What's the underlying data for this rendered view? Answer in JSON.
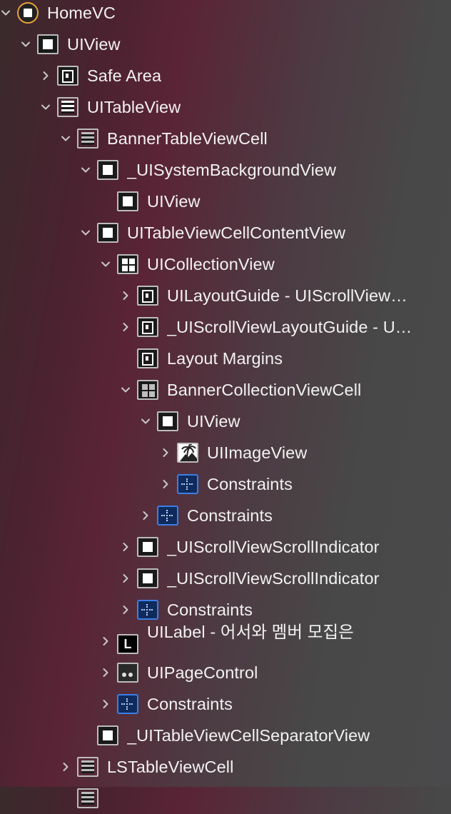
{
  "rows": [
    {
      "label": "HomeVC",
      "icon": "view-controller-icon",
      "indent": 0,
      "chevron": "expanded"
    },
    {
      "label": "UIView",
      "icon": "view-icon",
      "indent": 1,
      "chevron": "expanded"
    },
    {
      "label": "Safe Area",
      "icon": "layout-guide-icon",
      "indent": 2,
      "chevron": "collapsed"
    },
    {
      "label": "UITableView",
      "icon": "table-view-icon",
      "indent": 2,
      "chevron": "expanded"
    },
    {
      "label": "BannerTableViewCell",
      "icon": "table-cell-icon",
      "indent": 3,
      "chevron": "expanded"
    },
    {
      "label": "_UISystemBackgroundView",
      "icon": "view-icon",
      "indent": 4,
      "chevron": "expanded"
    },
    {
      "label": "UIView",
      "icon": "view-icon",
      "indent": 5,
      "chevron": "none"
    },
    {
      "label": "UITableViewCellContentView",
      "icon": "view-icon",
      "indent": 4,
      "chevron": "expanded"
    },
    {
      "label": "UICollectionView",
      "icon": "collection-view-icon",
      "indent": 5,
      "chevron": "expanded"
    },
    {
      "label": "UILayoutGuide - UIScrollView…",
      "icon": "layout-guide-icon",
      "indent": 6,
      "chevron": "collapsed"
    },
    {
      "label": "_UIScrollViewLayoutGuide - U…",
      "icon": "layout-guide-icon",
      "indent": 6,
      "chevron": "collapsed"
    },
    {
      "label": "Layout Margins",
      "icon": "layout-guide-icon",
      "indent": 6,
      "chevron": "none"
    },
    {
      "label": "BannerCollectionViewCell",
      "icon": "collection-cell-icon",
      "indent": 6,
      "chevron": "expanded"
    },
    {
      "label": "UIView",
      "icon": "view-icon",
      "indent": 7,
      "chevron": "expanded"
    },
    {
      "label": "UIImageView",
      "icon": "image-view-icon",
      "indent": 8,
      "chevron": "collapsed"
    },
    {
      "label": "Constraints",
      "icon": "constraints-icon",
      "indent": 8,
      "chevron": "collapsed"
    },
    {
      "label": "Constraints",
      "icon": "constraints-icon",
      "indent": 7,
      "chevron": "collapsed"
    },
    {
      "label": "_UIScrollViewScrollIndicator",
      "icon": "view-icon",
      "indent": 6,
      "chevron": "collapsed"
    },
    {
      "label": "_UIScrollViewScrollIndicator",
      "icon": "view-icon",
      "indent": 6,
      "chevron": "collapsed"
    },
    {
      "label": "Constraints",
      "icon": "constraints-icon",
      "indent": 6,
      "chevron": "collapsed"
    },
    {
      "label": "UILabel - 어서와 멤버 모집은",
      "icon": "label-icon",
      "indent": 5,
      "chevron": "collapsed"
    },
    {
      "label": "UIPageControl",
      "icon": "page-control-icon",
      "indent": 5,
      "chevron": "collapsed"
    },
    {
      "label": "Constraints",
      "icon": "constraints-icon",
      "indent": 5,
      "chevron": "collapsed"
    },
    {
      "label": "_UITableViewCellSeparatorView",
      "icon": "view-icon",
      "indent": 4,
      "chevron": "none"
    },
    {
      "label": "LSTableViewCell",
      "icon": "table-cell-icon",
      "indent": 3,
      "chevron": "collapsed"
    },
    {
      "label": "",
      "icon": "table-cell-icon",
      "indent": 3,
      "chevron": "none"
    }
  ],
  "label_glyph": "L"
}
